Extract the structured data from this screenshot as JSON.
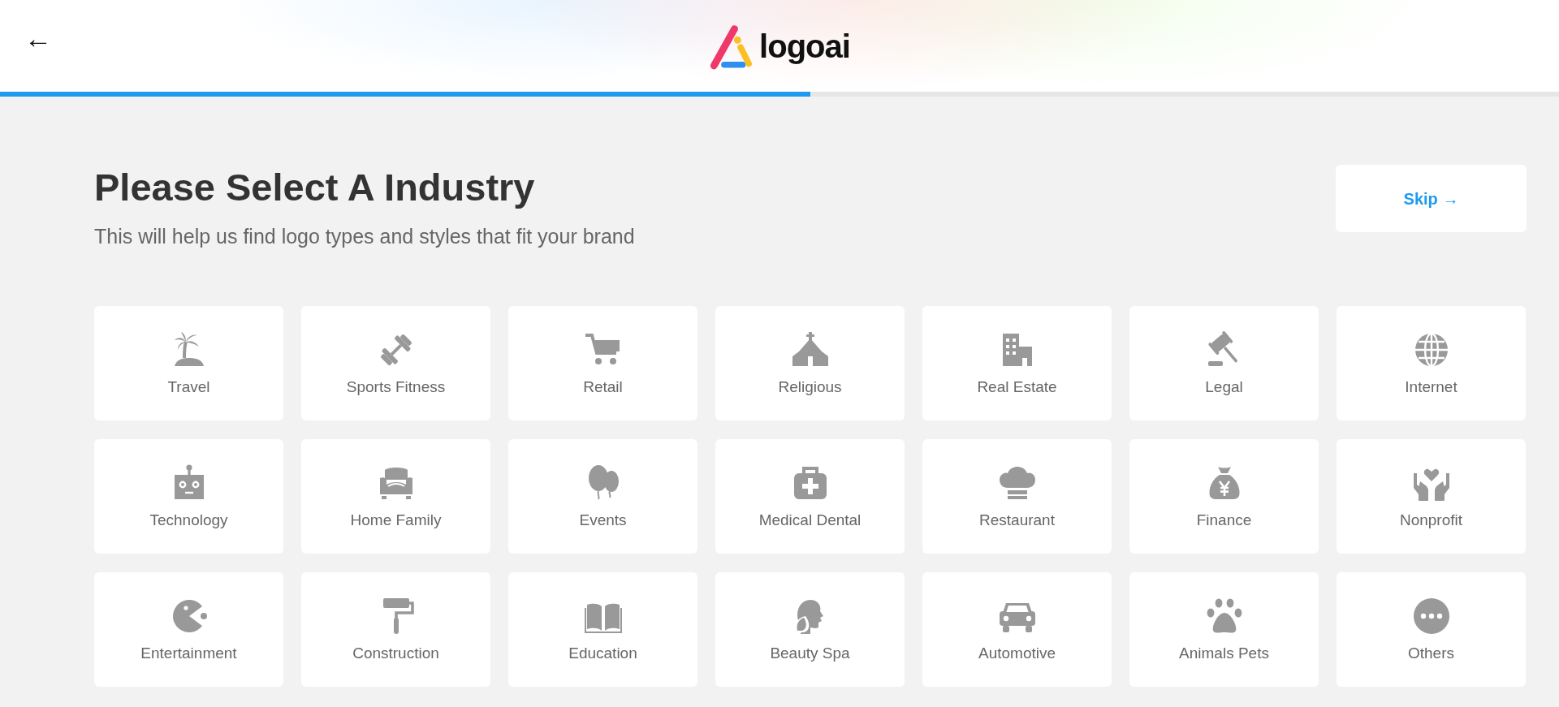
{
  "header": {
    "back_label": "←",
    "logo_text": "logoai"
  },
  "progress": {
    "level": 0.52
  },
  "heading": {
    "title": "Please Select A Industry",
    "subtitle": "This will help us find logo types and styles that fit your brand"
  },
  "skip_button": {
    "label": "Skip",
    "arrow": "→"
  },
  "industries": [
    {
      "label": "Travel"
    },
    {
      "label": "Sports Fitness"
    },
    {
      "label": "Retail"
    },
    {
      "label": "Religious"
    },
    {
      "label": "Real Estate"
    },
    {
      "label": "Legal"
    },
    {
      "label": "Internet"
    },
    {
      "label": "Technology"
    },
    {
      "label": "Home Family"
    },
    {
      "label": "Events"
    },
    {
      "label": "Medical Dental"
    },
    {
      "label": "Restaurant"
    },
    {
      "label": "Finance"
    },
    {
      "label": "Nonprofit"
    },
    {
      "label": "Entertainment"
    },
    {
      "label": "Construction"
    },
    {
      "label": "Education"
    },
    {
      "label": "Beauty Spa"
    },
    {
      "label": "Automotive"
    },
    {
      "label": "Animals Pets"
    },
    {
      "label": "Others"
    }
  ]
}
